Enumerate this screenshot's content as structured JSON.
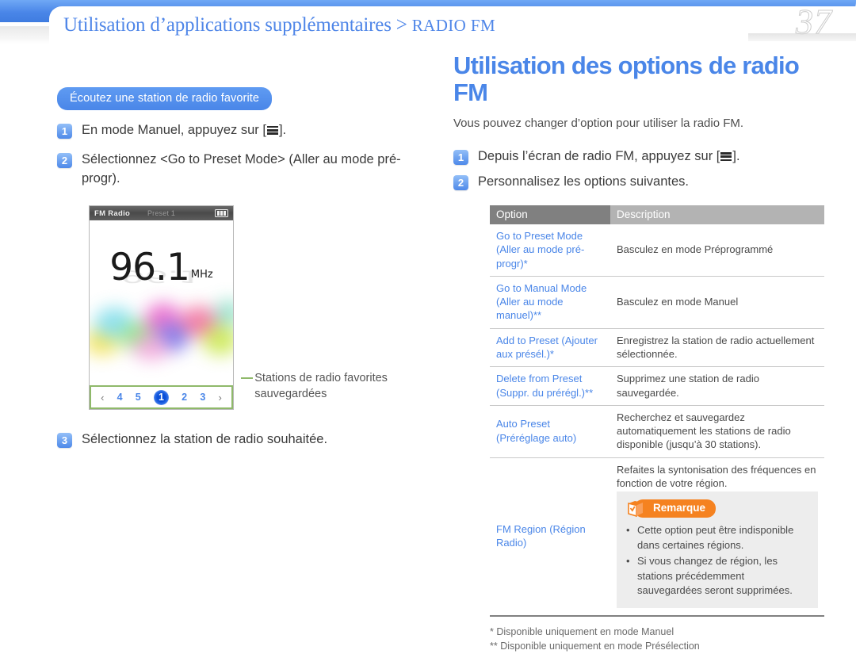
{
  "header": {
    "breadcrumb_main": "Utilisation d’applications supplémentaires >",
    "breadcrumb_tail": "RADIO FM",
    "page_number": "37",
    "accent_blue": "#4a86e8"
  },
  "left": {
    "pill_label": "Écoutez une station de radio favorite",
    "steps": [
      {
        "num": "1",
        "text_before": "En mode Manuel, appuyez sur [",
        "icon": "menu-icon",
        "text_after": "]."
      },
      {
        "num": "2",
        "text_before": "Sélectionnez <Go to Preset Mode> (Aller au mode pré-progr).",
        "icon": "",
        "text_after": ""
      }
    ],
    "step3": {
      "num": "3",
      "text": "Sélectionnez la station de radio souhaitée."
    },
    "device": {
      "status_title": "FM Radio",
      "status_preset": "Preset 1",
      "battery_icon": "battery-full-icon",
      "frequency": "96.1",
      "frequency_unit": "MHz",
      "preset_prev_icon": "chevron-left-icon",
      "preset_next_icon": "chevron-right-icon",
      "presets": [
        "4",
        "5",
        "1",
        "2",
        "3"
      ],
      "active_preset": "1",
      "highlight_color": "#8fb96a"
    },
    "callout": "Stations de radio favorites sauvegardées"
  },
  "right": {
    "title": "Utilisation des options de radio FM",
    "intro": "Vous pouvez changer d’option pour utiliser la radio FM.",
    "steps": [
      {
        "num": "1",
        "text_before": "Depuis l’écran de radio FM, appuyez sur [",
        "icon": "menu-icon",
        "text_after": "]."
      },
      {
        "num": "2",
        "text_before": "Personnalisez les options suivantes.",
        "icon": "",
        "text_after": ""
      }
    ],
    "table": {
      "headers": [
        "Option",
        "Description"
      ],
      "header_color_1": "#808080",
      "header_color_2": "#b3b3b3",
      "rows": [
        {
          "option": "Go to Preset Mode (Aller au mode pré-progr)*",
          "description": "Basculez en mode Préprogrammé"
        },
        {
          "option": "Go to Manual Mode (Aller au mode manuel)**",
          "description": "Basculez en mode Manuel"
        },
        {
          "option": "Add to Preset (Ajouter aux présél.)*",
          "description": "Enregistrez la station de radio actuellement sélectionnée."
        },
        {
          "option": "Delete from Preset (Suppr. du prérégl.)**",
          "description": "Supprimez une station de radio sauvegardée."
        },
        {
          "option": "Auto Preset (Préréglage auto)",
          "description": "Recherchez et sauvegardez automatiquement les stations de radio disponible (jusqu’à 30 stations)."
        },
        {
          "option": "FM Region (Région Radio)",
          "description": "Refaites la syntonisation des fréquences en fonction de votre région."
        }
      ]
    },
    "note": {
      "badge": "Remarque",
      "badge_color": "#f58220",
      "icon": "note-check-box-icon",
      "bullet": "•",
      "items": [
        "Cette option peut être indisponible dans certaines régions.",
        "Si vous changez de région, les stations précédemment sauvegardées seront supprimées."
      ]
    },
    "footnotes": [
      "* Disponible uniquement en mode Manuel",
      "** Disponible uniquement en mode Présélection"
    ]
  }
}
